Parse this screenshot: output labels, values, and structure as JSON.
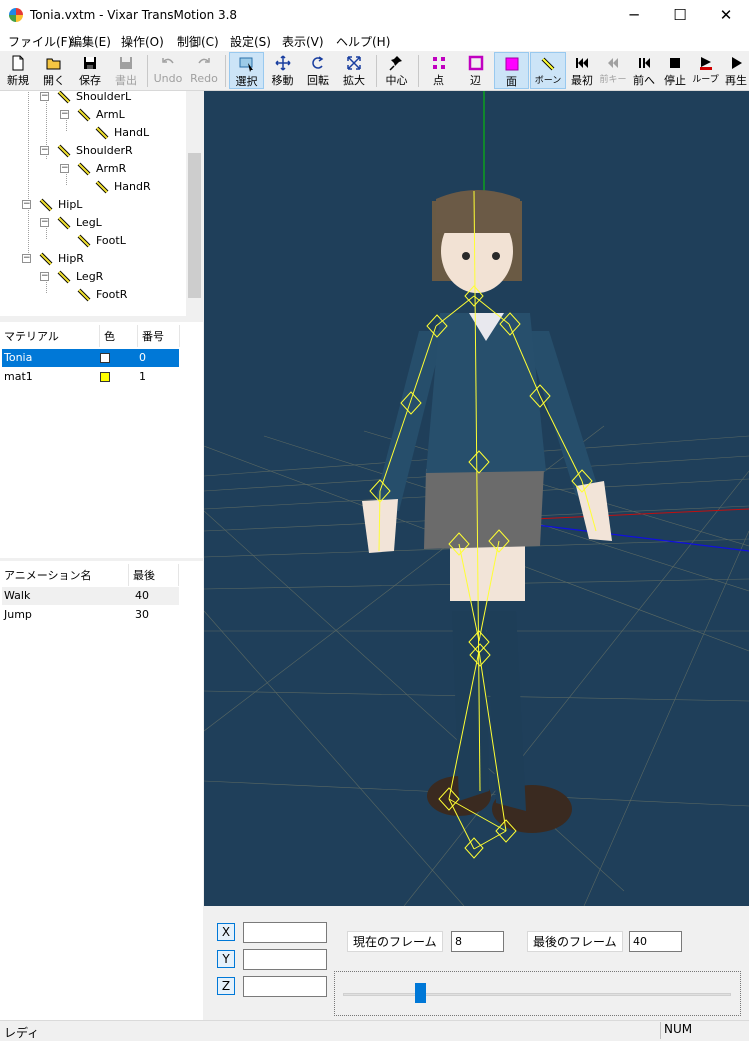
{
  "window": {
    "title": "Tonia.vxtm - Vixar TransMotion 3.8",
    "minimize_glyph": "─",
    "maximize_glyph": "☐",
    "close_glyph": "✕"
  },
  "menu": [
    "ファイル(F)",
    "編集(E)",
    "操作(O)",
    "制御(C)",
    "設定(S)",
    "表示(V)",
    "ヘルプ(H)"
  ],
  "toolbar": {
    "new": "新規",
    "open": "開く",
    "save": "保存",
    "export": "書出",
    "undo": "Undo",
    "redo": "Redo",
    "select": "選択",
    "move": "移動",
    "rotate": "回転",
    "zoom": "拡大",
    "center": "中心",
    "point": "点",
    "edge": "辺",
    "face": "面",
    "bone": "ボーン",
    "first": "最初",
    "prev_key": "前キー",
    "prev": "前へ",
    "stop": "停止",
    "loop": "ループ",
    "play": "再生"
  },
  "bone_tree": [
    {
      "label": "ShoulderL"
    },
    {
      "label": "ArmL"
    },
    {
      "label": "HandL"
    },
    {
      "label": "ShoulderR"
    },
    {
      "label": "ArmR"
    },
    {
      "label": "HandR"
    },
    {
      "label": "HipL"
    },
    {
      "label": "LegL"
    },
    {
      "label": "FootL"
    },
    {
      "label": "HipR"
    },
    {
      "label": "LegR"
    },
    {
      "label": "FootR"
    }
  ],
  "materials": {
    "headers": {
      "name": "マテリアル",
      "color": "色",
      "number": "番号"
    },
    "rows": [
      {
        "name": "Tonia",
        "color": "#ffffff",
        "number": "0",
        "selected": true
      },
      {
        "name": "mat1",
        "color": "#ffff00",
        "number": "1",
        "selected": false
      }
    ]
  },
  "animations": {
    "headers": {
      "name": "アニメーション名",
      "last": "最後"
    },
    "rows": [
      {
        "name": "Walk",
        "last": "40"
      },
      {
        "name": "Jump",
        "last": "30"
      }
    ]
  },
  "controls": {
    "x_label": "X",
    "y_label": "Y",
    "z_label": "Z",
    "x_value": "",
    "y_value": "",
    "z_value": "",
    "current_frame_label": "現在のフレーム",
    "current_frame": "8",
    "last_frame_label": "最後のフレーム",
    "last_frame": "40",
    "slider_fraction": 0.2
  },
  "status": {
    "left": "レディ",
    "num": "NUM"
  },
  "colors": {
    "viewport_bg": "#1f3f5a",
    "bone_yellow": "#ffff33",
    "selection_blue": "#0078d7",
    "face_magenta": "#ff00ff"
  }
}
